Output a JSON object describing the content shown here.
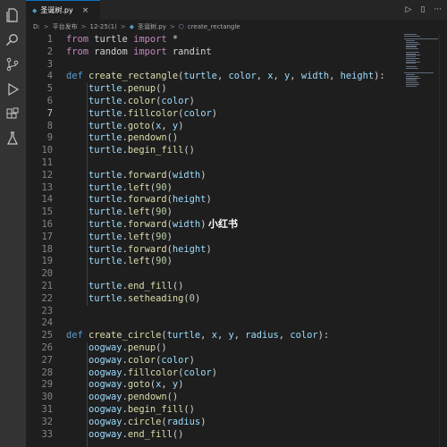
{
  "tab": {
    "filename": "圣诞树.py",
    "py_glyph": "◆",
    "close": "×"
  },
  "top_actions": {
    "run": "▷",
    "split": "▯",
    "more": "···"
  },
  "breadcrumb": {
    "parts": [
      "D:",
      "平台发布",
      "12-25(1)",
      "圣诞树.py",
      "create_rectangle"
    ],
    "sep": ">"
  },
  "watermark": "小红书",
  "editor": {
    "active_line": 7,
    "lines": [
      {
        "n": "1",
        "t": [
          [
            "kw",
            "from "
          ],
          [
            "pl",
            "turtle "
          ],
          [
            "kw",
            "import "
          ],
          [
            "pl",
            "*"
          ]
        ]
      },
      {
        "n": "2",
        "t": [
          [
            "kw",
            "from "
          ],
          [
            "pl",
            "random "
          ],
          [
            "kw",
            "import "
          ],
          [
            "pl",
            "randint"
          ]
        ]
      },
      {
        "n": "3",
        "t": []
      },
      {
        "n": "4",
        "t": [
          [
            "def",
            "def "
          ],
          [
            "fn",
            "create_rectangle"
          ],
          [
            "pl",
            "("
          ],
          [
            "var",
            "turtle"
          ],
          [
            "pl",
            ", "
          ],
          [
            "var",
            "color"
          ],
          [
            "pl",
            ", "
          ],
          [
            "var",
            "x"
          ],
          [
            "pl",
            ", "
          ],
          [
            "var",
            "y"
          ],
          [
            "pl",
            ", "
          ],
          [
            "var",
            "width"
          ],
          [
            "pl",
            ", "
          ],
          [
            "var",
            "height"
          ],
          [
            "pl",
            "):"
          ]
        ]
      },
      {
        "n": "5",
        "t": [
          [
            "pl",
            "    "
          ],
          [
            "var",
            "turtle"
          ],
          [
            "pl",
            "."
          ],
          [
            "fn",
            "penup"
          ],
          [
            "pl",
            "()"
          ]
        ]
      },
      {
        "n": "6",
        "t": [
          [
            "pl",
            "    "
          ],
          [
            "var",
            "turtle"
          ],
          [
            "pl",
            "."
          ],
          [
            "fn",
            "color"
          ],
          [
            "pl",
            "("
          ],
          [
            "var",
            "color"
          ],
          [
            "pl",
            ")"
          ]
        ]
      },
      {
        "n": "7",
        "t": [
          [
            "pl",
            "    "
          ],
          [
            "var",
            "turtle"
          ],
          [
            "pl",
            "."
          ],
          [
            "fn",
            "fillcolor"
          ],
          [
            "pl",
            "("
          ],
          [
            "var",
            "color"
          ],
          [
            "pl",
            ")"
          ]
        ]
      },
      {
        "n": "8",
        "t": [
          [
            "pl",
            "    "
          ],
          [
            "var",
            "turtle"
          ],
          [
            "pl",
            "."
          ],
          [
            "fn",
            "goto"
          ],
          [
            "pl",
            "("
          ],
          [
            "var",
            "x"
          ],
          [
            "pl",
            ", "
          ],
          [
            "var",
            "y"
          ],
          [
            "pl",
            ")"
          ]
        ]
      },
      {
        "n": "9",
        "t": [
          [
            "pl",
            "    "
          ],
          [
            "var",
            "turtle"
          ],
          [
            "pl",
            "."
          ],
          [
            "fn",
            "pendown"
          ],
          [
            "pl",
            "()"
          ]
        ]
      },
      {
        "n": "10",
        "t": [
          [
            "pl",
            "    "
          ],
          [
            "var",
            "turtle"
          ],
          [
            "pl",
            "."
          ],
          [
            "fn",
            "begin_fill"
          ],
          [
            "pl",
            "()"
          ]
        ]
      },
      {
        "n": "11",
        "t": []
      },
      {
        "n": "12",
        "t": [
          [
            "pl",
            "    "
          ],
          [
            "var",
            "turtle"
          ],
          [
            "pl",
            "."
          ],
          [
            "fn",
            "forward"
          ],
          [
            "pl",
            "("
          ],
          [
            "var",
            "width"
          ],
          [
            "pl",
            ")"
          ]
        ]
      },
      {
        "n": "13",
        "t": [
          [
            "pl",
            "    "
          ],
          [
            "var",
            "turtle"
          ],
          [
            "pl",
            "."
          ],
          [
            "fn",
            "left"
          ],
          [
            "pl",
            "("
          ],
          [
            "num",
            "90"
          ],
          [
            "pl",
            ")"
          ]
        ]
      },
      {
        "n": "14",
        "t": [
          [
            "pl",
            "    "
          ],
          [
            "var",
            "turtle"
          ],
          [
            "pl",
            "."
          ],
          [
            "fn",
            "forward"
          ],
          [
            "pl",
            "("
          ],
          [
            "var",
            "height"
          ],
          [
            "pl",
            ")"
          ]
        ]
      },
      {
        "n": "15",
        "t": [
          [
            "pl",
            "    "
          ],
          [
            "var",
            "turtle"
          ],
          [
            "pl",
            "."
          ],
          [
            "fn",
            "left"
          ],
          [
            "pl",
            "("
          ],
          [
            "num",
            "90"
          ],
          [
            "pl",
            ")"
          ]
        ]
      },
      {
        "n": "16",
        "t": [
          [
            "pl",
            "    "
          ],
          [
            "var",
            "turtle"
          ],
          [
            "pl",
            "."
          ],
          [
            "fn",
            "forward"
          ],
          [
            "pl",
            "("
          ],
          [
            "var",
            "width"
          ],
          [
            "pl",
            ")"
          ]
        ]
      },
      {
        "n": "17",
        "t": [
          [
            "pl",
            "    "
          ],
          [
            "var",
            "turtle"
          ],
          [
            "pl",
            "."
          ],
          [
            "fn",
            "left"
          ],
          [
            "pl",
            "("
          ],
          [
            "num",
            "90"
          ],
          [
            "pl",
            ")"
          ]
        ]
      },
      {
        "n": "18",
        "t": [
          [
            "pl",
            "    "
          ],
          [
            "var",
            "turtle"
          ],
          [
            "pl",
            "."
          ],
          [
            "fn",
            "forward"
          ],
          [
            "pl",
            "("
          ],
          [
            "var",
            "height"
          ],
          [
            "pl",
            ")"
          ]
        ]
      },
      {
        "n": "19",
        "t": [
          [
            "pl",
            "    "
          ],
          [
            "var",
            "turtle"
          ],
          [
            "pl",
            "."
          ],
          [
            "fn",
            "left"
          ],
          [
            "pl",
            "("
          ],
          [
            "num",
            "90"
          ],
          [
            "pl",
            ")"
          ]
        ]
      },
      {
        "n": "20",
        "t": []
      },
      {
        "n": "21",
        "t": [
          [
            "pl",
            "    "
          ],
          [
            "var",
            "turtle"
          ],
          [
            "pl",
            "."
          ],
          [
            "fn",
            "end_fill"
          ],
          [
            "pl",
            "()"
          ]
        ]
      },
      {
        "n": "22",
        "t": [
          [
            "pl",
            "    "
          ],
          [
            "var",
            "turtle"
          ],
          [
            "pl",
            "."
          ],
          [
            "fn",
            "setheading"
          ],
          [
            "pl",
            "("
          ],
          [
            "num",
            "0"
          ],
          [
            "pl",
            ")"
          ]
        ]
      },
      {
        "n": "23",
        "t": []
      },
      {
        "n": "24",
        "t": []
      },
      {
        "n": "25",
        "t": [
          [
            "def",
            "def "
          ],
          [
            "fn",
            "create_circle"
          ],
          [
            "pl",
            "("
          ],
          [
            "var",
            "turtle"
          ],
          [
            "pl",
            ", "
          ],
          [
            "var",
            "x"
          ],
          [
            "pl",
            ", "
          ],
          [
            "var",
            "y"
          ],
          [
            "pl",
            ", "
          ],
          [
            "var",
            "radius"
          ],
          [
            "pl",
            ", "
          ],
          [
            "var",
            "color"
          ],
          [
            "pl",
            "):"
          ]
        ]
      },
      {
        "n": "26",
        "t": [
          [
            "pl",
            "    "
          ],
          [
            "var",
            "oogway"
          ],
          [
            "pl",
            "."
          ],
          [
            "fn",
            "penup"
          ],
          [
            "pl",
            "()"
          ]
        ]
      },
      {
        "n": "27",
        "t": [
          [
            "pl",
            "    "
          ],
          [
            "var",
            "oogway"
          ],
          [
            "pl",
            "."
          ],
          [
            "fn",
            "color"
          ],
          [
            "pl",
            "("
          ],
          [
            "var",
            "color"
          ],
          [
            "pl",
            ")"
          ]
        ]
      },
      {
        "n": "28",
        "t": [
          [
            "pl",
            "    "
          ],
          [
            "var",
            "oogway"
          ],
          [
            "pl",
            "."
          ],
          [
            "fn",
            "fillcolor"
          ],
          [
            "pl",
            "("
          ],
          [
            "var",
            "color"
          ],
          [
            "pl",
            ")"
          ]
        ]
      },
      {
        "n": "29",
        "t": [
          [
            "pl",
            "    "
          ],
          [
            "var",
            "oogway"
          ],
          [
            "pl",
            "."
          ],
          [
            "fn",
            "goto"
          ],
          [
            "pl",
            "("
          ],
          [
            "var",
            "x"
          ],
          [
            "pl",
            ", "
          ],
          [
            "var",
            "y"
          ],
          [
            "pl",
            ")"
          ]
        ]
      },
      {
        "n": "30",
        "t": [
          [
            "pl",
            "    "
          ],
          [
            "var",
            "oogway"
          ],
          [
            "pl",
            "."
          ],
          [
            "fn",
            "pendown"
          ],
          [
            "pl",
            "()"
          ]
        ]
      },
      {
        "n": "31",
        "t": [
          [
            "pl",
            "    "
          ],
          [
            "var",
            "oogway"
          ],
          [
            "pl",
            "."
          ],
          [
            "fn",
            "begin_fill"
          ],
          [
            "pl",
            "()"
          ]
        ]
      },
      {
        "n": "32",
        "t": [
          [
            "pl",
            "    "
          ],
          [
            "var",
            "oogway"
          ],
          [
            "pl",
            "."
          ],
          [
            "fn",
            "circle"
          ],
          [
            "pl",
            "("
          ],
          [
            "var",
            "radius"
          ],
          [
            "pl",
            ")"
          ]
        ]
      },
      {
        "n": "33",
        "t": [
          [
            "pl",
            "    "
          ],
          [
            "var",
            "oogway"
          ],
          [
            "pl",
            "."
          ],
          [
            "fn",
            "end_fill"
          ],
          [
            "pl",
            "()"
          ]
        ]
      }
    ]
  },
  "colors": {
    "editor_bg": "#1e1e1e",
    "keyword": "#c586c0",
    "def_keyword": "#569cd6",
    "function": "#dcdcaa",
    "variable": "#9cdcfe",
    "number": "#b5cea8"
  },
  "activity_icons": [
    "files-icon",
    "search-icon",
    "source-control-icon",
    "run-debug-icon",
    "extensions-icon",
    "testing-icon"
  ]
}
